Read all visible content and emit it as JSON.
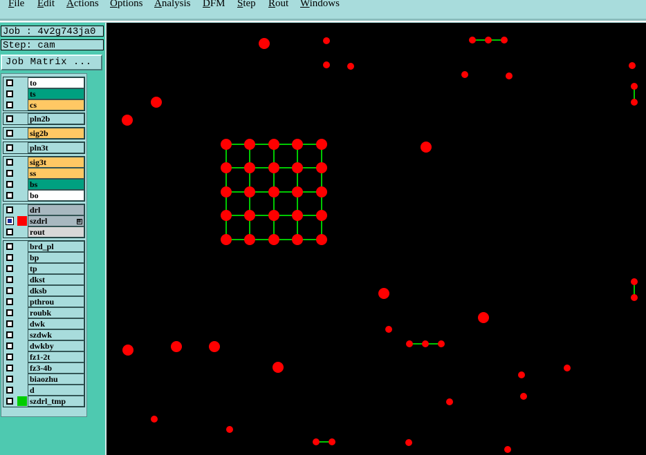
{
  "menu": [
    {
      "label": "File",
      "mnemonic": "F"
    },
    {
      "label": "Edit",
      "mnemonic": "E"
    },
    {
      "label": "Actions",
      "mnemonic": "A"
    },
    {
      "label": "Options",
      "mnemonic": "O"
    },
    {
      "label": "Analysis",
      "mnemonic": "A"
    },
    {
      "label": "DFM",
      "mnemonic": "D"
    },
    {
      "label": "Step",
      "mnemonic": "S"
    },
    {
      "label": "Rout",
      "mnemonic": "R"
    },
    {
      "label": "Windows",
      "mnemonic": "W"
    }
  ],
  "info": {
    "job_line": "Job : 4v2g743ja0",
    "step_line": "Step: cam",
    "job_matrix_button": "Job Matrix ..."
  },
  "colors": {
    "board": "#c0c0c0",
    "signal": "#ffc864",
    "mask": "#00a080",
    "silk": "#ffffff",
    "drill_active": "#ff0000",
    "tmp": "#00cc00",
    "misc": "#a8dcdc",
    "pad": "#ff0000",
    "trace": "#00c800"
  },
  "layer_groups": [
    [
      {
        "name": "to",
        "color": "#ffffff",
        "swatch": ""
      },
      {
        "name": "ts",
        "color": "#00a080",
        "swatch": ""
      },
      {
        "name": "cs",
        "color": "#ffc864",
        "swatch": ""
      }
    ],
    [
      {
        "name": "pln2b",
        "color": "#a8dcdc",
        "swatch": ""
      }
    ],
    [
      {
        "name": "sig2b",
        "color": "#ffc864",
        "swatch": ""
      }
    ],
    [
      {
        "name": "pln3t",
        "color": "#a8dcdc",
        "swatch": ""
      }
    ],
    [
      {
        "name": "sig3t",
        "color": "#ffc864",
        "swatch": ""
      },
      {
        "name": "ss",
        "color": "#ffc864",
        "swatch": ""
      },
      {
        "name": "bs",
        "color": "#00a080",
        "swatch": ""
      },
      {
        "name": "bo",
        "color": "#ffffff",
        "swatch": ""
      }
    ],
    [
      {
        "name": "drl",
        "color": "#a8b8c0",
        "swatch": ""
      },
      {
        "name": "szdrl",
        "color": "#a8b8c0",
        "swatch": "#ff0000",
        "checked": true,
        "marker": "⊞"
      },
      {
        "name": "rout",
        "color": "#d8d8d8",
        "swatch": ""
      }
    ],
    [
      {
        "name": "brd_pl",
        "color": "#a8dcdc",
        "swatch": ""
      },
      {
        "name": "bp",
        "color": "#a8dcdc",
        "swatch": ""
      },
      {
        "name": "tp",
        "color": "#a8dcdc",
        "swatch": ""
      },
      {
        "name": "dkst",
        "color": "#a8dcdc",
        "swatch": ""
      },
      {
        "name": "dksb",
        "color": "#a8dcdc",
        "swatch": ""
      },
      {
        "name": "pthrou",
        "color": "#a8dcdc",
        "swatch": ""
      },
      {
        "name": "roubk",
        "color": "#a8dcdc",
        "swatch": ""
      },
      {
        "name": "dwk",
        "color": "#a8dcdc",
        "swatch": ""
      },
      {
        "name": "szdwk",
        "color": "#a8dcdc",
        "swatch": ""
      },
      {
        "name": "dwkby",
        "color": "#a8dcdc",
        "swatch": ""
      },
      {
        "name": "fz1-2t",
        "color": "#a8dcdc",
        "swatch": ""
      },
      {
        "name": "fz3-4b",
        "color": "#a8dcdc",
        "swatch": ""
      },
      {
        "name": "biaozhu",
        "color": "#a8dcdc",
        "swatch": ""
      },
      {
        "name": "d",
        "color": "#a8dcdc",
        "swatch": ""
      },
      {
        "name": "szdrl_tmp",
        "color": "#a8dcdc",
        "swatch": "#00cc00"
      }
    ]
  ]
}
